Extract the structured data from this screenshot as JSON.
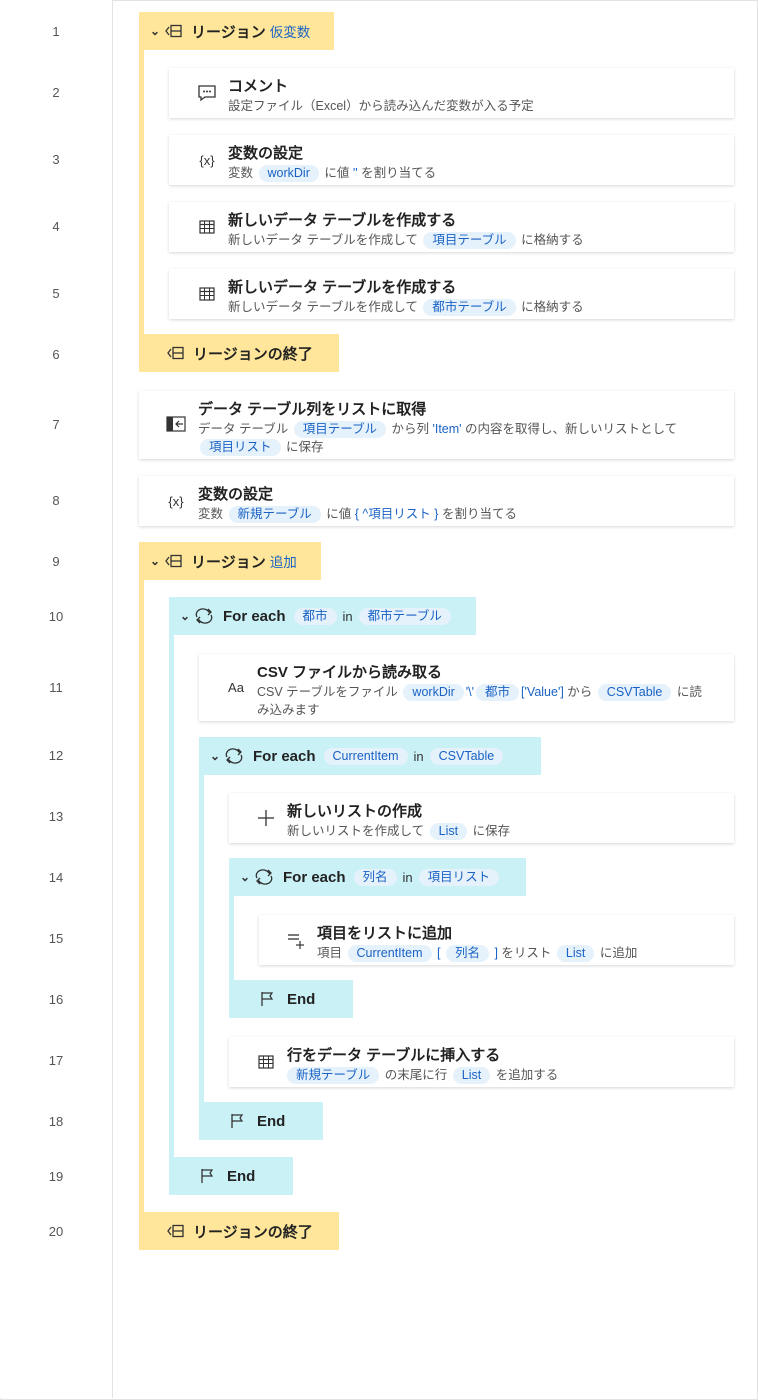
{
  "line_numbers": [
    "1",
    "2",
    "3",
    "4",
    "5",
    "6",
    "7",
    "8",
    "9",
    "10",
    "11",
    "12",
    "13",
    "14",
    "15",
    "16",
    "17",
    "18",
    "19",
    "20"
  ],
  "steps": {
    "s1": {
      "title": "リージョン",
      "name": "仮変数"
    },
    "s2": {
      "title": "コメント",
      "desc": "設定ファイル（Excel）から読み込んだ変数が入る予定"
    },
    "s3": {
      "title": "変数の設定",
      "d1": "変数",
      "v1": "workDir",
      "d2": "に値",
      "lit": "''",
      "d3": "を割り当てる"
    },
    "s4": {
      "title": "新しいデータ テーブルを作成する",
      "d1": "新しいデータ テーブルを作成して",
      "v1": "項目テーブル",
      "d2": "に格納する"
    },
    "s5": {
      "title": "新しいデータ テーブルを作成する",
      "d1": "新しいデータ テーブルを作成して",
      "v1": "都市テーブル",
      "d2": "に格納する"
    },
    "s6": {
      "title": "リージョンの終了"
    },
    "s7": {
      "title": "データ テーブル列をリストに取得",
      "d1": "データ テーブル",
      "v1": "項目テーブル",
      "d2": "から列",
      "lit": "'Item'",
      "d3": "の内容を取得し、新しいリストとして",
      "v2": "項目リスト",
      "d4": "に保存"
    },
    "s8": {
      "title": "変数の設定",
      "d1": "変数",
      "v1": "新規テーブル",
      "d2": "に値",
      "lit1": "{ ^",
      "v2": "項目リスト",
      "lit2": "}",
      "d3": "を割り当てる"
    },
    "s9": {
      "title": "リージョン",
      "name": "追加"
    },
    "s10": {
      "title": "For each",
      "v1": "都市",
      "in": "in",
      "v2": "都市テーブル"
    },
    "s11": {
      "title": "CSV ファイルから読み取る",
      "d1": "CSV テーブルをファイル",
      "v1": "workDir",
      "lit1": "'\\'",
      "v2": "都市",
      "lit2": "['Value']",
      "d2": "から",
      "v3": "CSVTable",
      "d3": "に読み込みます"
    },
    "s12": {
      "title": "For each",
      "v1": "CurrentItem",
      "in": "in",
      "v2": "CSVTable"
    },
    "s13": {
      "title": "新しいリストの作成",
      "d1": "新しいリストを作成して",
      "v1": "List",
      "d2": "に保存"
    },
    "s14": {
      "title": "For each",
      "v1": "列名",
      "in": "in",
      "v2": "項目リスト"
    },
    "s15": {
      "title": "項目をリストに追加",
      "d1": "項目",
      "v1": "CurrentItem",
      "lit1": "[",
      "v2": "列名",
      "lit2": "]",
      "d2": "をリスト",
      "v3": "List",
      "d3": "に追加"
    },
    "s16": {
      "title": "End"
    },
    "s17": {
      "title": "行をデータ テーブルに挿入する",
      "v1": "新規テーブル",
      "d1": "の末尾に行",
      "v2": "List",
      "d2": "を追加する"
    },
    "s18": {
      "title": "End"
    },
    "s19": {
      "title": "End"
    },
    "s20": {
      "title": "リージョンの終了"
    }
  },
  "colors": {
    "region": "#ffe69a",
    "loop": "#c9f1f6",
    "variable": "#1a63c5",
    "variable_bg": "#e5f1fb"
  }
}
